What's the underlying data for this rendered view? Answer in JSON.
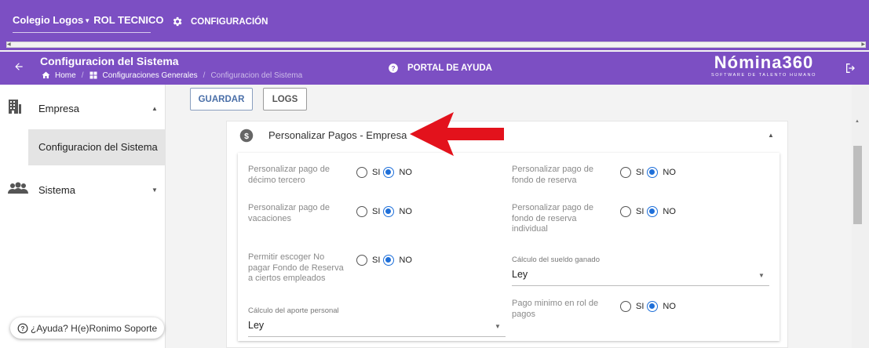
{
  "topbar": {
    "org_name": "Colegio Logos",
    "role": "ROL TECNICO",
    "config_label": "CONFIGURACIÓN"
  },
  "header": {
    "title": "Configuracion del Sistema",
    "breadcrumbs": [
      "Home",
      "Configuraciones Generales",
      "Configuracion del Sistema"
    ],
    "help_label": "PORTAL DE AYUDA",
    "logo_main": "Nómina360",
    "logo_sub": "SOFTWARE DE TALENTO HUMANO"
  },
  "sidebar": {
    "items": [
      {
        "label": "Empresa",
        "icon": "building-icon",
        "expanded": true
      },
      {
        "label": "Configuracion del Sistema",
        "selected": true
      },
      {
        "label": "Sistema",
        "icon": "people-icon",
        "expanded": false
      }
    ],
    "help_chip": "¿Ayuda? H(e)Ronimo Soporte"
  },
  "toolbar": {
    "save_label": "GUARDAR",
    "logs_label": "LOGS"
  },
  "panel": {
    "title": "Personalizar Pagos - Empresa",
    "radio_si": "SI",
    "radio_no": "NO",
    "fields": {
      "decimo_tercero": "Personalizar pago de décimo tercero",
      "fondo_reserva": "Personalizar pago de fondo de reserva",
      "vacaciones": "Personalizar pago de vacaciones",
      "fondo_reserva_individual": "Personalizar pago de fondo de reserva individual",
      "no_pagar_fondo": "Permitir escoger No pagar Fondo de Reserva a ciertos empleados",
      "pago_minimo": "Pago minimo en rol de pagos"
    },
    "selects": {
      "sueldo_ganado": {
        "label": "Cálculo del sueldo ganado",
        "value": "Ley"
      },
      "aporte_personal": {
        "label": "Cálculo del aporte personal",
        "value": "Ley"
      }
    },
    "selected_option": "NO"
  },
  "colors": {
    "primary": "#7c4fc3",
    "radio_selected": "#1e6fd9",
    "arrow": "#e3121c"
  }
}
